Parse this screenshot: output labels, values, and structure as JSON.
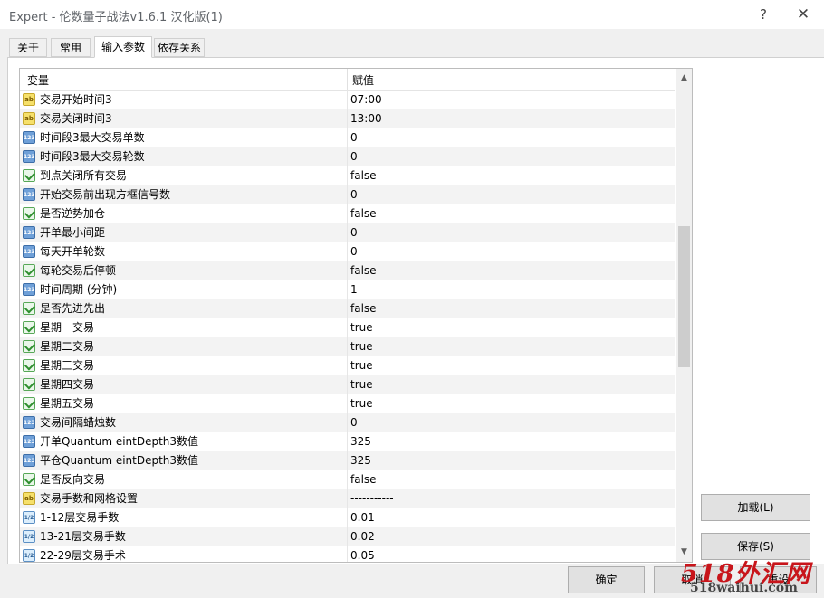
{
  "window": {
    "title": "Expert - 伦数量子战法v1.6.1 汉化版(1)",
    "help_glyph": "?",
    "close_glyph": "✕"
  },
  "tabs": [
    {
      "label": "关于",
      "active": false
    },
    {
      "label": "常用",
      "active": false
    },
    {
      "label": "输入参数",
      "active": true
    },
    {
      "label": "依存关系",
      "active": false
    }
  ],
  "table": {
    "headers": {
      "variable": "变量",
      "value": "赋值"
    },
    "rows": [
      {
        "type": "str",
        "icon": "ab",
        "name": "交易开始时间3",
        "value": "07:00"
      },
      {
        "type": "str",
        "icon": "ab",
        "name": "交易关闭时间3",
        "value": "13:00"
      },
      {
        "type": "int",
        "icon": "123",
        "name": "时间段3最大交易单数",
        "value": "0"
      },
      {
        "type": "int",
        "icon": "123",
        "name": "时间段3最大交易轮数",
        "value": "0"
      },
      {
        "type": "bool",
        "icon": "",
        "name": "到点关闭所有交易",
        "value": "false"
      },
      {
        "type": "int",
        "icon": "123",
        "name": "开始交易前出现方框信号数",
        "value": "0"
      },
      {
        "type": "bool",
        "icon": "",
        "name": "是否逆势加仓",
        "value": "false"
      },
      {
        "type": "int",
        "icon": "123",
        "name": "开单最小间距",
        "value": "0"
      },
      {
        "type": "int",
        "icon": "123",
        "name": "每天开单轮数",
        "value": "0"
      },
      {
        "type": "bool",
        "icon": "",
        "name": "每轮交易后停顿",
        "value": "false"
      },
      {
        "type": "int",
        "icon": "123",
        "name": "时间周期 (分钟)",
        "value": "1"
      },
      {
        "type": "bool",
        "icon": "",
        "name": "是否先进先出",
        "value": "false"
      },
      {
        "type": "bool",
        "icon": "",
        "name": "星期一交易",
        "value": "true"
      },
      {
        "type": "bool",
        "icon": "",
        "name": "星期二交易",
        "value": "true"
      },
      {
        "type": "bool",
        "icon": "",
        "name": "星期三交易",
        "value": "true"
      },
      {
        "type": "bool",
        "icon": "",
        "name": "星期四交易",
        "value": "true"
      },
      {
        "type": "bool",
        "icon": "",
        "name": "星期五交易",
        "value": "true"
      },
      {
        "type": "int",
        "icon": "123",
        "name": "交易间隔蜡烛数",
        "value": "0"
      },
      {
        "type": "int",
        "icon": "123",
        "name": "开单Quantum eintDepth3数值",
        "value": "325"
      },
      {
        "type": "int",
        "icon": "123",
        "name": "平仓Quantum eintDepth3数值",
        "value": "325"
      },
      {
        "type": "bool",
        "icon": "",
        "name": "是否反向交易",
        "value": "false"
      },
      {
        "type": "str",
        "icon": "ab",
        "name": "交易手数和网格设置",
        "value": "-----------"
      },
      {
        "type": "dbl",
        "icon": "1/2",
        "name": "1-12层交易手数",
        "value": "0.01"
      },
      {
        "type": "dbl",
        "icon": "1/2",
        "name": "13-21层交易手数",
        "value": "0.02"
      },
      {
        "type": "dbl",
        "icon": "1/2",
        "name": "22-29层交易手术",
        "value": "0.05"
      }
    ]
  },
  "scrollbar": {
    "up_glyph": "▲",
    "down_glyph": "▼",
    "position_fraction": 0.32
  },
  "buttons": {
    "load": "加载(L)",
    "save": "保存(S)",
    "ok": "确定",
    "cancel": "取消",
    "reset": "重设"
  },
  "watermark": {
    "line1": "518外汇网",
    "line2": "518waihui.com"
  }
}
